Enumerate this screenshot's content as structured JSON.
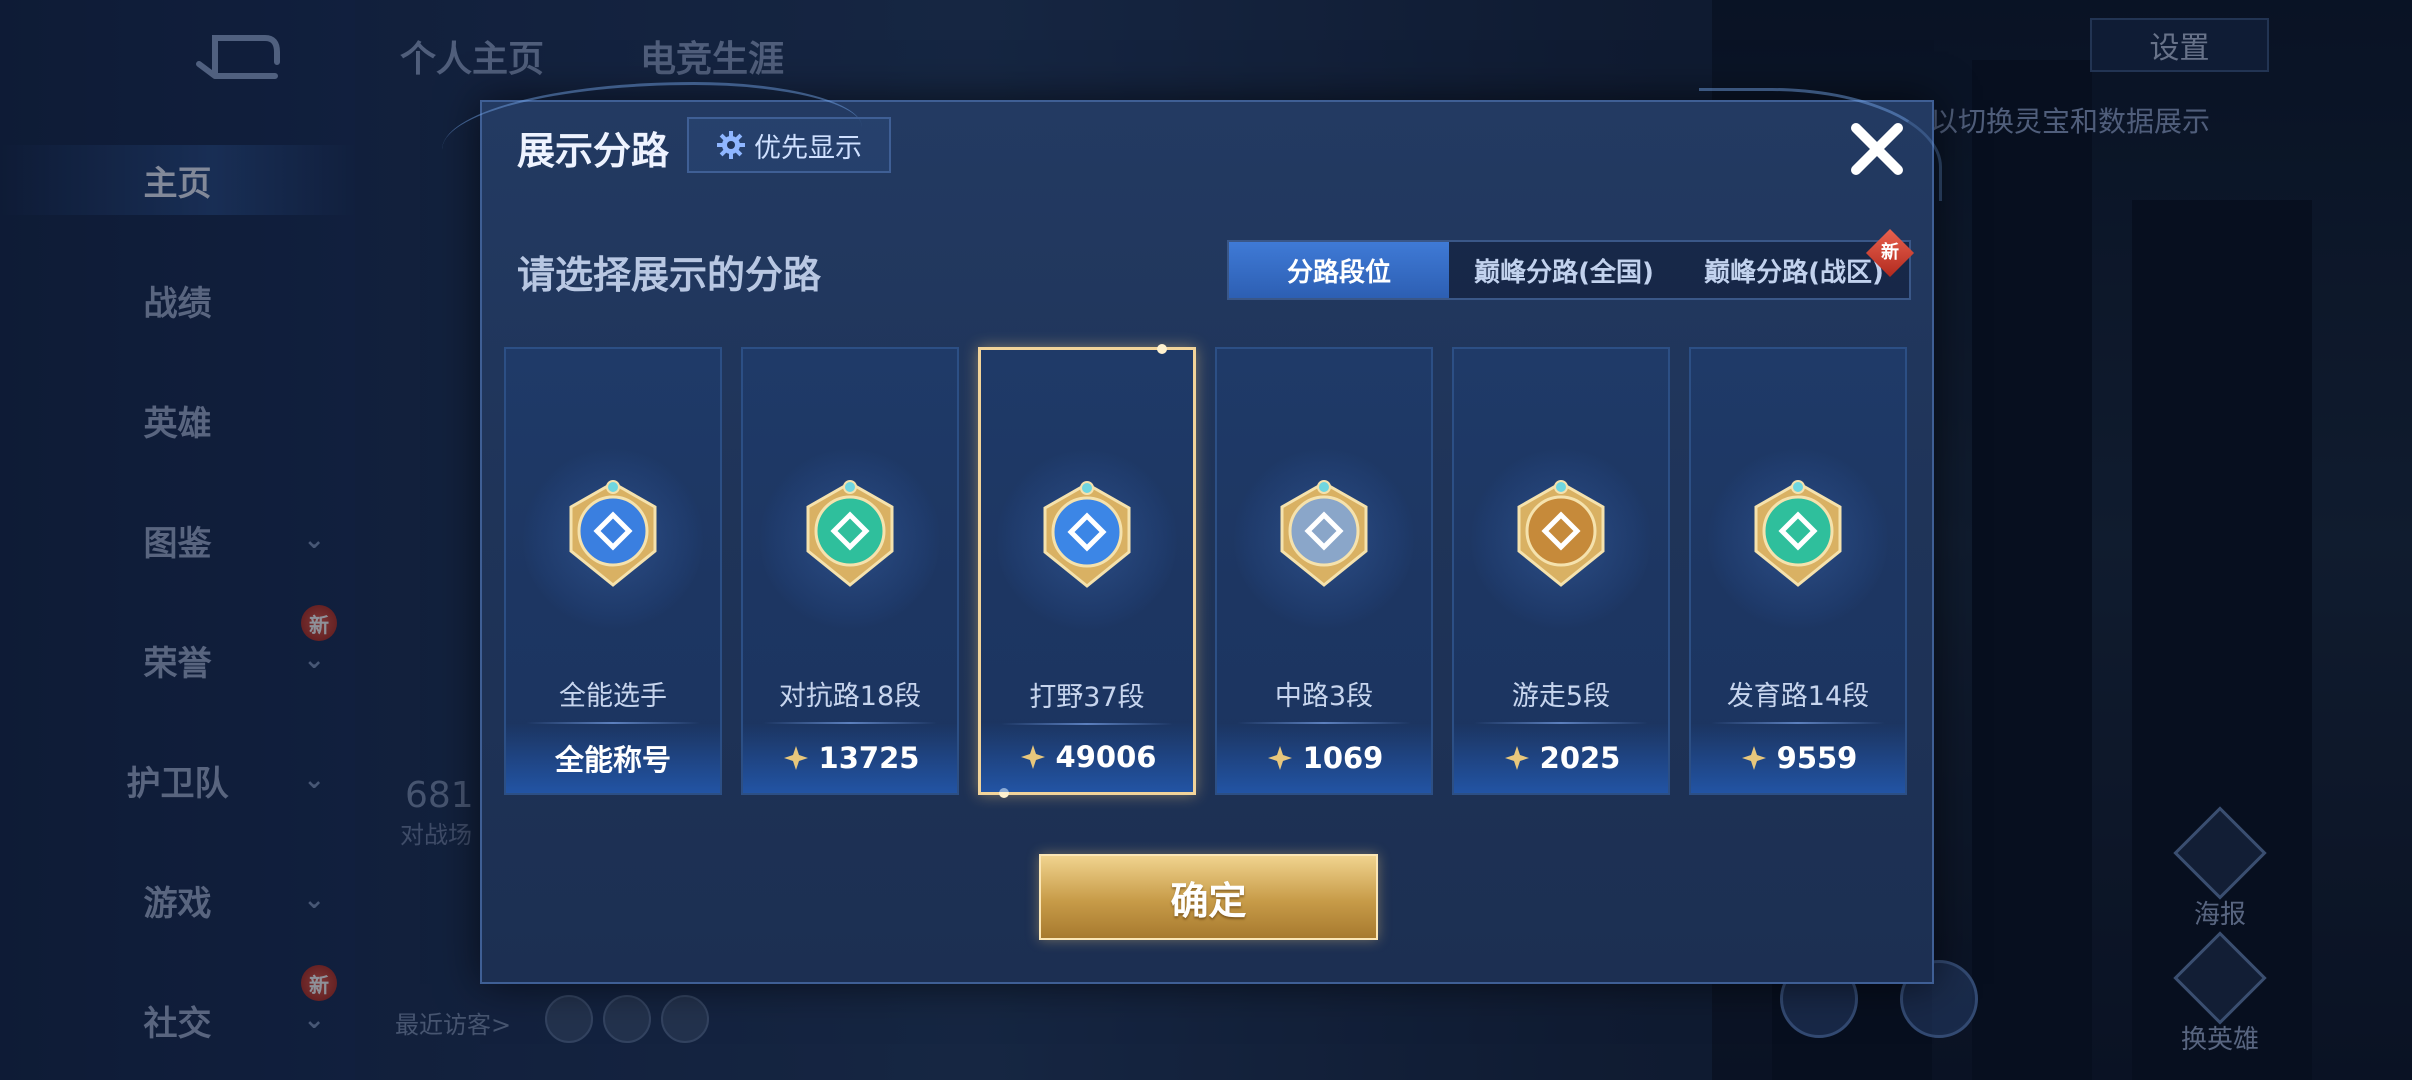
{
  "background": {
    "sidebar": {
      "items": [
        {
          "label": "主页",
          "chevron": false,
          "new": false,
          "active": true
        },
        {
          "label": "战绩",
          "chevron": false,
          "new": false,
          "active": false
        },
        {
          "label": "英雄",
          "chevron": false,
          "new": false,
          "active": false
        },
        {
          "label": "图鉴",
          "chevron": true,
          "new": false,
          "active": false
        },
        {
          "label": "荣誉",
          "chevron": true,
          "new": true,
          "active": false
        },
        {
          "label": "护卫队",
          "chevron": true,
          "new": false,
          "active": false
        },
        {
          "label": "游戏",
          "chevron": true,
          "new": false,
          "active": false
        },
        {
          "label": "社交",
          "chevron": true,
          "new": true,
          "active": false
        }
      ],
      "new_badge": "新"
    },
    "tabs": [
      "个人主页",
      "电竞生涯"
    ],
    "settings_label": "设置",
    "tip_text": "以切换灵宝和数据展示",
    "stat_number": "681",
    "stat_label": "对战场",
    "visitors_label": "最近访客>",
    "right_buttons": {
      "poster": "海报",
      "switch_hero": "换英雄"
    }
  },
  "modal": {
    "title": "展示分路",
    "priority_label": "优先显示",
    "subtitle": "请选择展示的分路",
    "tabs": [
      {
        "label": "分路段位",
        "active": true
      },
      {
        "label": "巅峰分路(全国)",
        "active": false
      },
      {
        "label": "巅峰分路(战区)",
        "active": false,
        "badge": "新"
      }
    ],
    "cards": [
      {
        "name": "全能选手",
        "value": "全能称号",
        "points_icon": false,
        "selected": false,
        "medal_color": "#3a7fe0",
        "medal_icon": "all-round-medal-icon"
      },
      {
        "name": "对抗路18段",
        "value": "13725",
        "points_icon": true,
        "selected": false,
        "medal_color": "#2fbf9c",
        "medal_icon": "clash-lane-medal-icon"
      },
      {
        "name": "打野37段",
        "value": "49006",
        "points_icon": true,
        "selected": true,
        "medal_color": "#3c86e6",
        "medal_icon": "jungle-medal-icon"
      },
      {
        "name": "中路3段",
        "value": "1069",
        "points_icon": true,
        "selected": false,
        "medal_color": "#8aa6c9",
        "medal_icon": "mid-lane-medal-icon"
      },
      {
        "name": "游走5段",
        "value": "2025",
        "points_icon": true,
        "selected": false,
        "medal_color": "#c68a3a",
        "medal_icon": "roam-medal-icon"
      },
      {
        "name": "发育路14段",
        "value": "9559",
        "points_icon": true,
        "selected": false,
        "medal_color": "#2fbf9c",
        "medal_icon": "farm-lane-medal-icon"
      }
    ],
    "confirm_label": "确定"
  }
}
